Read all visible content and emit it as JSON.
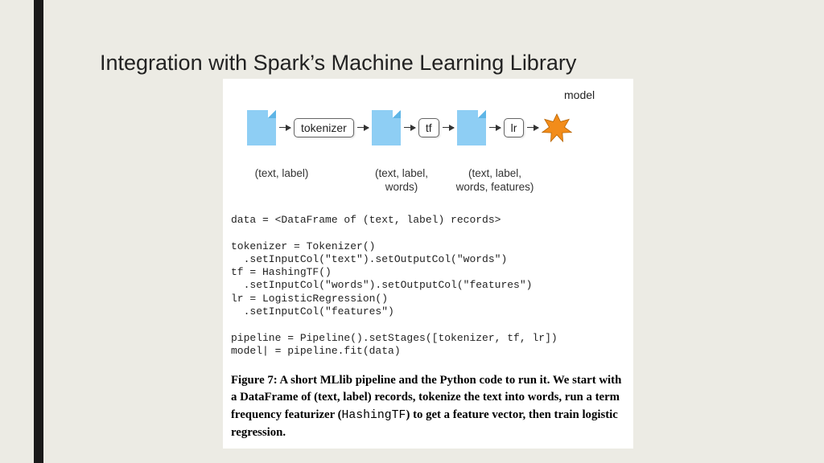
{
  "title": "Integration with Spark’s Machine Learning Library",
  "diagram": {
    "stages": [
      "tokenizer",
      "tf",
      "lr"
    ],
    "output_label": "model",
    "sublabels": [
      "(text, label)",
      "(text, label,\nwords)",
      "(text, label,\nwords, features)"
    ]
  },
  "code": "data = <DataFrame of (text, label) records>\n\ntokenizer = Tokenizer()\n  .setInputCol(\"text\").setOutputCol(\"words\")\ntf = HashingTF()\n  .setInputCol(\"words\").setOutputCol(\"features\")\nlr = LogisticRegression()\n  .setInputCol(\"features\")\n\npipeline = Pipeline().setStages([tokenizer, tf, lr])\nmodel| = pipeline.fit(data)",
  "caption": {
    "lead": "Figure 7: A short MLlib pipeline and the Python code to run it. We start with a DataFrame of (text, label) records, tokenize the text into words, run a term frequency featurizer (",
    "mono": "HashingTF",
    "tail": ") to get a feature vector, then train logistic regression."
  }
}
